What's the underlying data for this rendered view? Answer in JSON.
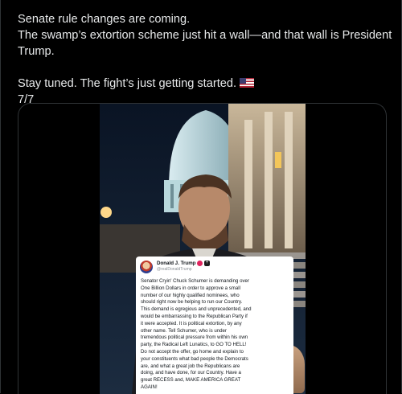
{
  "tweet": {
    "lines": [
      "Senate rule changes are coming.",
      "The swamp’s extortion scheme just hit a wall—and that wall is President",
      "Trump.",
      "",
      "Stay tuned. The fight’s just getting started.",
      "7/7"
    ],
    "flag_icon": "us-flag-emoji"
  },
  "media": {
    "type": "video",
    "embedded_post": {
      "name": "Donald J. Trump",
      "handle": "@realDonaldTrump",
      "plus_glyph": "+",
      "body_lines": [
        "Senator Cryin' Chuck Schumer is demanding over",
        "One Billion Dollars in order to approve a small",
        "number of our highly qualified nominees, who",
        "should right now be helping to run our Country.",
        "This demand is egregious and unprecedented, and",
        "would be embarrassing to the Republican Party if",
        "it were accepted. It is political extortion, by any",
        "other name. Tell Schumer, who is under",
        "tremendous political pressure from within his own",
        "party, the Radical Left Lunatics, to GO TO HELL!",
        "Do not accept the offer, go home and explain to",
        "your constituents what bad people the Democrats",
        "are, and what a great job the Republicans are",
        "doing, and have done, for our Country. Have a",
        "great RECESS and, MAKE AMERICA GREAT",
        "AGAIN!"
      ]
    }
  }
}
